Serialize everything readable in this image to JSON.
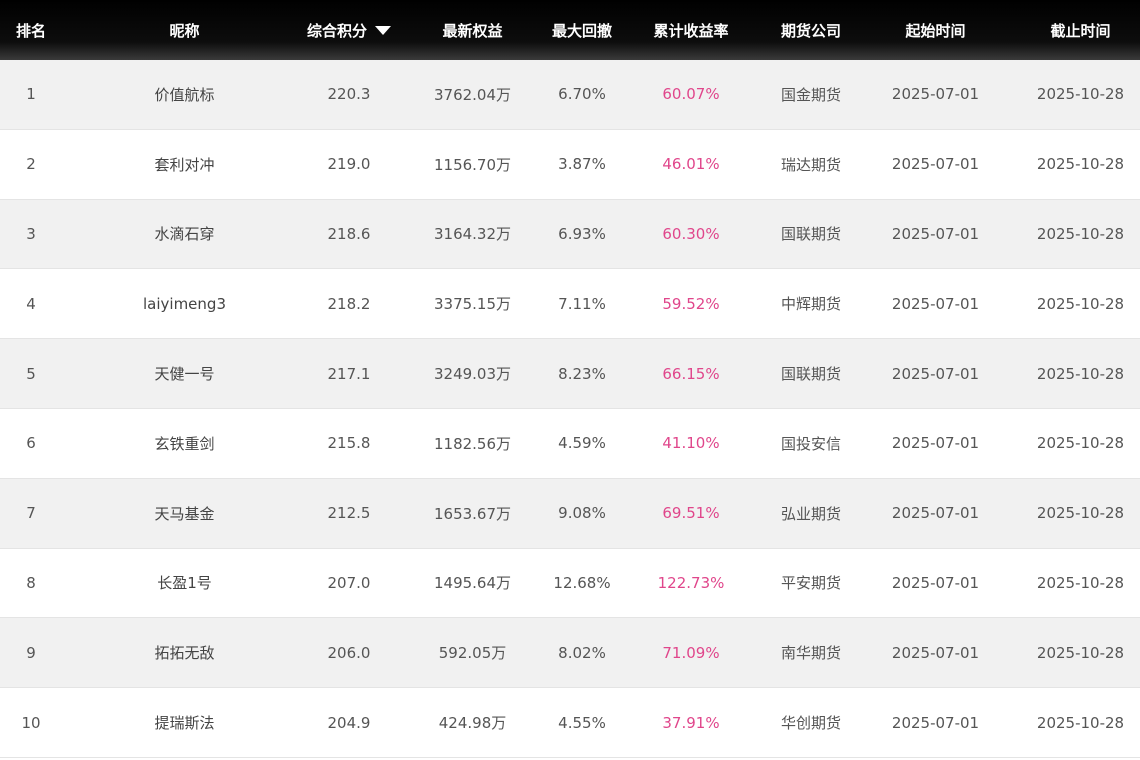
{
  "table": {
    "headers": {
      "rank": "排名",
      "nickname": "昵称",
      "score": "综合积分",
      "equity": "最新权益",
      "drawdown": "最大回撤",
      "return": "累计收益率",
      "company": "期货公司",
      "start": "起始时间",
      "end": "截止时间"
    },
    "sort_icon": "sort-desc-triangle-icon",
    "accent_color": "#e0468b",
    "rows": [
      {
        "rank": "1",
        "nickname": "价值航标",
        "score": "220.3",
        "equity": "3762.04万",
        "drawdown": "6.70%",
        "return": "60.07%",
        "company": "国金期货",
        "start": "2025-07-01",
        "end": "2025-10-28"
      },
      {
        "rank": "2",
        "nickname": "套利对冲",
        "score": "219.0",
        "equity": "1156.70万",
        "drawdown": "3.87%",
        "return": "46.01%",
        "company": "瑞达期货",
        "start": "2025-07-01",
        "end": "2025-10-28"
      },
      {
        "rank": "3",
        "nickname": "水滴石穿",
        "score": "218.6",
        "equity": "3164.32万",
        "drawdown": "6.93%",
        "return": "60.30%",
        "company": "国联期货",
        "start": "2025-07-01",
        "end": "2025-10-28"
      },
      {
        "rank": "4",
        "nickname": "laiyimeng3",
        "score": "218.2",
        "equity": "3375.15万",
        "drawdown": "7.11%",
        "return": "59.52%",
        "company": "中辉期货",
        "start": "2025-07-01",
        "end": "2025-10-28"
      },
      {
        "rank": "5",
        "nickname": "天健一号",
        "score": "217.1",
        "equity": "3249.03万",
        "drawdown": "8.23%",
        "return": "66.15%",
        "company": "国联期货",
        "start": "2025-07-01",
        "end": "2025-10-28"
      },
      {
        "rank": "6",
        "nickname": "玄铁重剑",
        "score": "215.8",
        "equity": "1182.56万",
        "drawdown": "4.59%",
        "return": "41.10%",
        "company": "国投安信",
        "start": "2025-07-01",
        "end": "2025-10-28"
      },
      {
        "rank": "7",
        "nickname": "天马基金",
        "score": "212.5",
        "equity": "1653.67万",
        "drawdown": "9.08%",
        "return": "69.51%",
        "company": "弘业期货",
        "start": "2025-07-01",
        "end": "2025-10-28"
      },
      {
        "rank": "8",
        "nickname": "长盈1号",
        "score": "207.0",
        "equity": "1495.64万",
        "drawdown": "12.68%",
        "return": "122.73%",
        "company": "平安期货",
        "start": "2025-07-01",
        "end": "2025-10-28"
      },
      {
        "rank": "9",
        "nickname": "拓拓无敌",
        "score": "206.0",
        "equity": "592.05万",
        "drawdown": "8.02%",
        "return": "71.09%",
        "company": "南华期货",
        "start": "2025-07-01",
        "end": "2025-10-28"
      },
      {
        "rank": "10",
        "nickname": "提瑞斯法",
        "score": "204.9",
        "equity": "424.98万",
        "drawdown": "4.55%",
        "return": "37.91%",
        "company": "华创期货",
        "start": "2025-07-01",
        "end": "2025-10-28"
      }
    ]
  }
}
